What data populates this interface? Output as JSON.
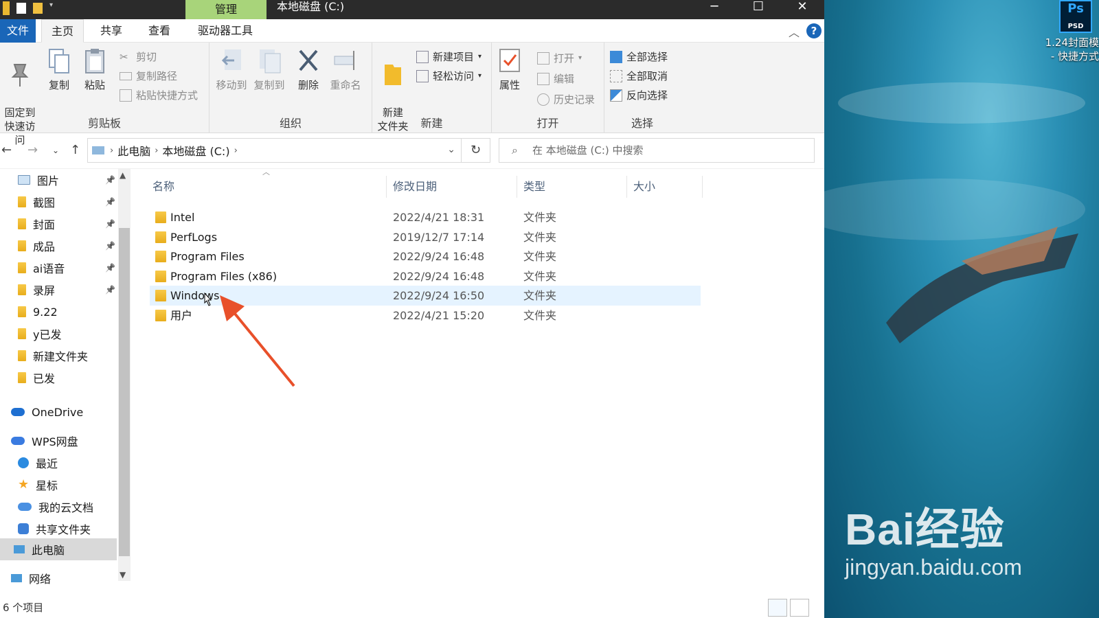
{
  "window": {
    "title": "本地磁盘 (C:)",
    "context_tab": "管理"
  },
  "tabs": {
    "file": "文件",
    "home": "主页",
    "share": "共享",
    "view": "查看",
    "drive_tools": "驱动器工具"
  },
  "ribbon": {
    "clipboard": {
      "label": "剪贴板",
      "pin": "固定到\n快速访问",
      "copy": "复制",
      "paste": "粘贴",
      "cut": "剪切",
      "copy_path": "复制路径",
      "paste_shortcut": "粘贴快捷方式"
    },
    "organize": {
      "label": "组织",
      "move_to": "移动到",
      "copy_to": "复制到",
      "delete": "删除",
      "rename": "重命名"
    },
    "new": {
      "label": "新建",
      "new_folder": "新建\n文件夹",
      "new_item": "新建项目",
      "easy_access": "轻松访问"
    },
    "open": {
      "label": "打开",
      "properties": "属性",
      "open": "打开",
      "edit": "编辑",
      "history": "历史记录"
    },
    "select": {
      "label": "选择",
      "select_all": "全部选择",
      "select_none": "全部取消",
      "invert": "反向选择"
    }
  },
  "address": {
    "crumbs": [
      "此电脑",
      "本地磁盘 (C:)"
    ],
    "search_placeholder": "在 本地磁盘 (C:) 中搜索"
  },
  "nav": {
    "quick": [
      {
        "label": "图片",
        "pinned": true,
        "icon": "pictures-icon"
      },
      {
        "label": "截图",
        "pinned": true,
        "icon": "folder-icon"
      },
      {
        "label": "封面",
        "pinned": true,
        "icon": "folder-icon"
      },
      {
        "label": "成品",
        "pinned": true,
        "icon": "folder-icon"
      },
      {
        "label": "ai语音",
        "pinned": true,
        "icon": "folder-icon"
      },
      {
        "label": "录屏",
        "pinned": true,
        "icon": "folder-icon"
      },
      {
        "label": "9.22",
        "pinned": false,
        "icon": "folder-icon"
      },
      {
        "label": "y已发",
        "pinned": false,
        "icon": "folder-icon"
      },
      {
        "label": "新建文件夹",
        "pinned": false,
        "icon": "folder-icon"
      },
      {
        "label": "已发",
        "pinned": false,
        "icon": "folder-icon"
      }
    ],
    "onedrive": "OneDrive",
    "wps": "WPS网盘",
    "wps_items": [
      "最近",
      "星标",
      "我的云文档",
      "共享文件夹"
    ],
    "this_pc": "此电脑",
    "network": "网络"
  },
  "columns": {
    "name": "名称",
    "modified": "修改日期",
    "type": "类型",
    "size": "大小"
  },
  "files": [
    {
      "name": "Intel",
      "date": "2022/4/21 18:31",
      "type": "文件夹"
    },
    {
      "name": "PerfLogs",
      "date": "2019/12/7 17:14",
      "type": "文件夹"
    },
    {
      "name": "Program Files",
      "date": "2022/9/24 16:48",
      "type": "文件夹"
    },
    {
      "name": "Program Files (x86)",
      "date": "2022/9/24 16:48",
      "type": "文件夹"
    },
    {
      "name": "Windows",
      "date": "2022/9/24 16:50",
      "type": "文件夹",
      "selected": true
    },
    {
      "name": "用户",
      "date": "2022/4/21 15:20",
      "type": "文件夹"
    }
  ],
  "status": {
    "count": "6 个项目"
  },
  "desktop": {
    "psd_badge": "Ps",
    "psd_tag": "PSD",
    "shortcut_label": "1.24封面模\n- 快捷方式",
    "watermark_big": "Bai经验",
    "watermark_url": "jingyan.baidu.com"
  },
  "colors": {
    "accent": "#1a66b8",
    "manage_tab": "#a8d47a",
    "selection": "#e5f3ff",
    "arrow": "#e8502a"
  }
}
